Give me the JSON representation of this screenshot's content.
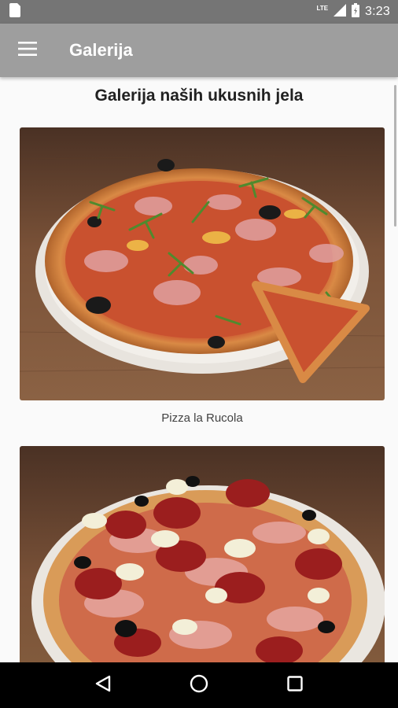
{
  "status_bar": {
    "time": "3:23",
    "network": "LTE",
    "icons": [
      "sim-card-icon",
      "signal-icon",
      "battery-icon"
    ]
  },
  "app_bar": {
    "title": "Galerija",
    "menu_icon": "hamburger-menu-icon"
  },
  "page": {
    "heading": "Galerija naših ukusnih jela"
  },
  "gallery": [
    {
      "caption": "Pizza la Rucola",
      "image": "pizza-rucola-photo"
    },
    {
      "caption": "",
      "image": "pizza-salami-photo"
    }
  ],
  "nav_bar": {
    "icons": [
      "back-icon",
      "home-icon",
      "recents-icon"
    ]
  },
  "colors": {
    "status_bar": "#757575",
    "app_bar": "#9e9e9e",
    "background": "#fafafa",
    "nav_bar": "#000000"
  }
}
